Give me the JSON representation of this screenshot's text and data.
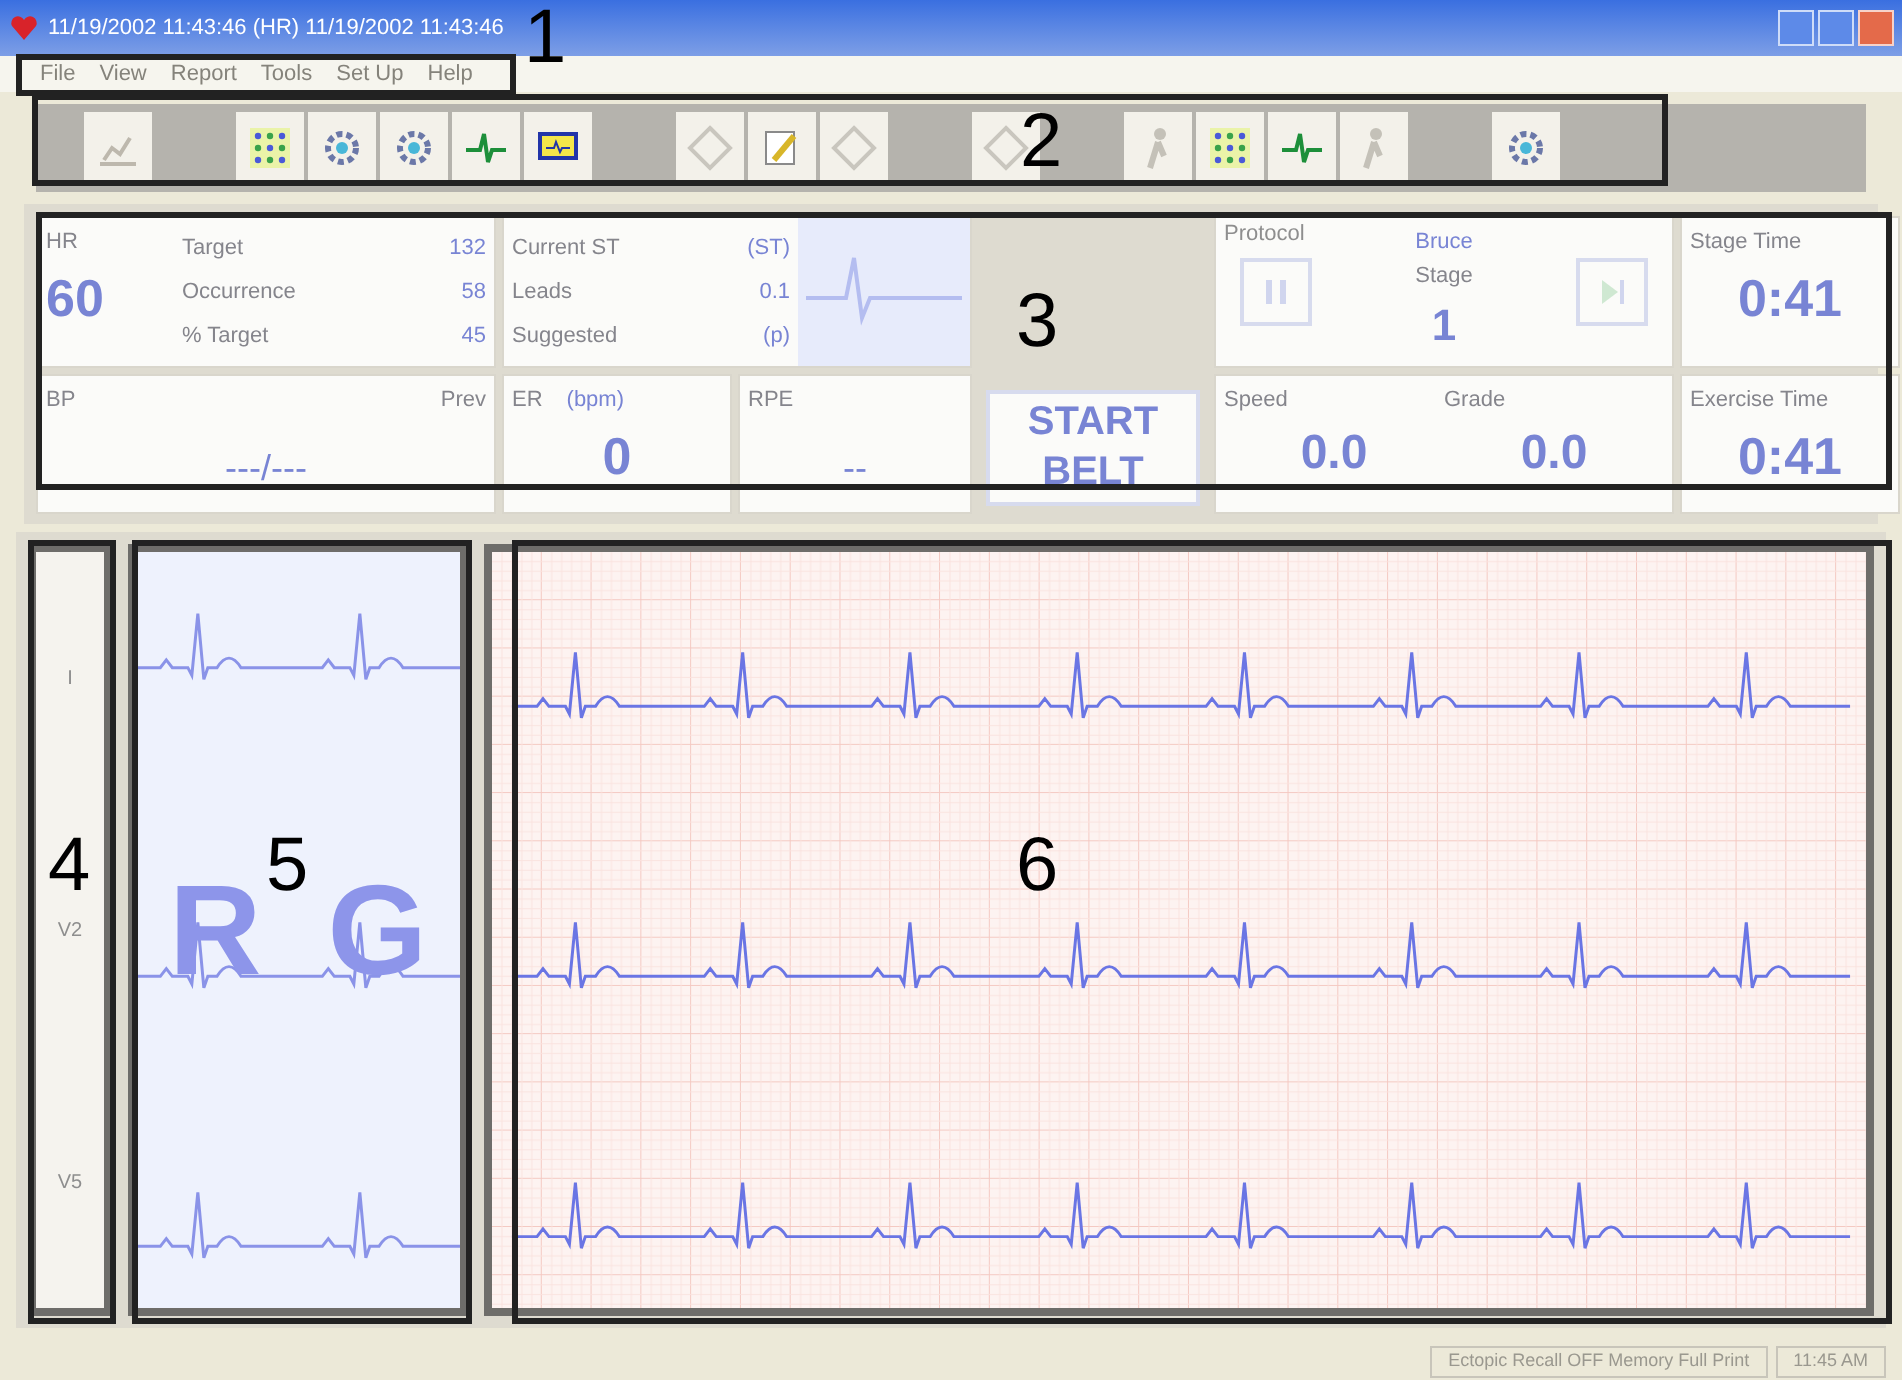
{
  "window": {
    "title": "11/19/2002 11:43:46  (HR) 11/19/2002 11:43:46"
  },
  "menu": [
    "File",
    "View",
    "Report",
    "Tools",
    "Set Up",
    "Help"
  ],
  "toolbar": [
    {
      "kind": "patient"
    },
    {
      "kind": "gap"
    },
    {
      "kind": "grid"
    },
    {
      "kind": "gear"
    },
    {
      "kind": "gear"
    },
    {
      "kind": "lead"
    },
    {
      "kind": "monitor"
    },
    {
      "kind": "gap"
    },
    {
      "kind": "diamond"
    },
    {
      "kind": "pen"
    },
    {
      "kind": "diamond"
    },
    {
      "kind": "gap"
    },
    {
      "kind": "diamond"
    },
    {
      "kind": "gap"
    },
    {
      "kind": "person"
    },
    {
      "kind": "grid"
    },
    {
      "kind": "lead"
    },
    {
      "kind": "person"
    },
    {
      "kind": "gap"
    },
    {
      "kind": "gear"
    }
  ],
  "hr": {
    "label": "HR",
    "value": "60",
    "rows": [
      {
        "label": "Target",
        "value": "132"
      },
      {
        "label": "Occurrence",
        "value": "58"
      },
      {
        "label": "% Target",
        "value": "45"
      }
    ]
  },
  "st": {
    "rows": [
      {
        "label": "Current ST",
        "value": "(ST)"
      },
      {
        "label": "Leads",
        "value": "0.1"
      },
      {
        "label": "Suggested",
        "value": "(p)"
      }
    ]
  },
  "bp": {
    "label": "BP",
    "prev": "Prev",
    "value": "---/---"
  },
  "er": {
    "label": "ER",
    "unit": "(bpm)",
    "value": "0"
  },
  "rpe": {
    "label": "RPE",
    "value": "--"
  },
  "start_button": "START BELT",
  "protocol": {
    "label": "Protocol",
    "name": "Bruce",
    "stage_label": "Stage",
    "stage": "1"
  },
  "speed": {
    "label": "Speed",
    "value": "0.0"
  },
  "grade": {
    "label": "Grade",
    "value": "0.0"
  },
  "stage_time": {
    "label": "Stage Time",
    "value": "0:41"
  },
  "exercise_time": {
    "label": "Exercise Time",
    "value": "0:41"
  },
  "leads": [
    "I",
    "V2",
    "V5"
  ],
  "average_letters": [
    "R",
    "G"
  ],
  "status_bar": [
    "Ectopic Recall OFF   Memory Full Print",
    "11:45 AM"
  ],
  "callouts": [
    "1",
    "2",
    "3",
    "4",
    "5",
    "6"
  ]
}
